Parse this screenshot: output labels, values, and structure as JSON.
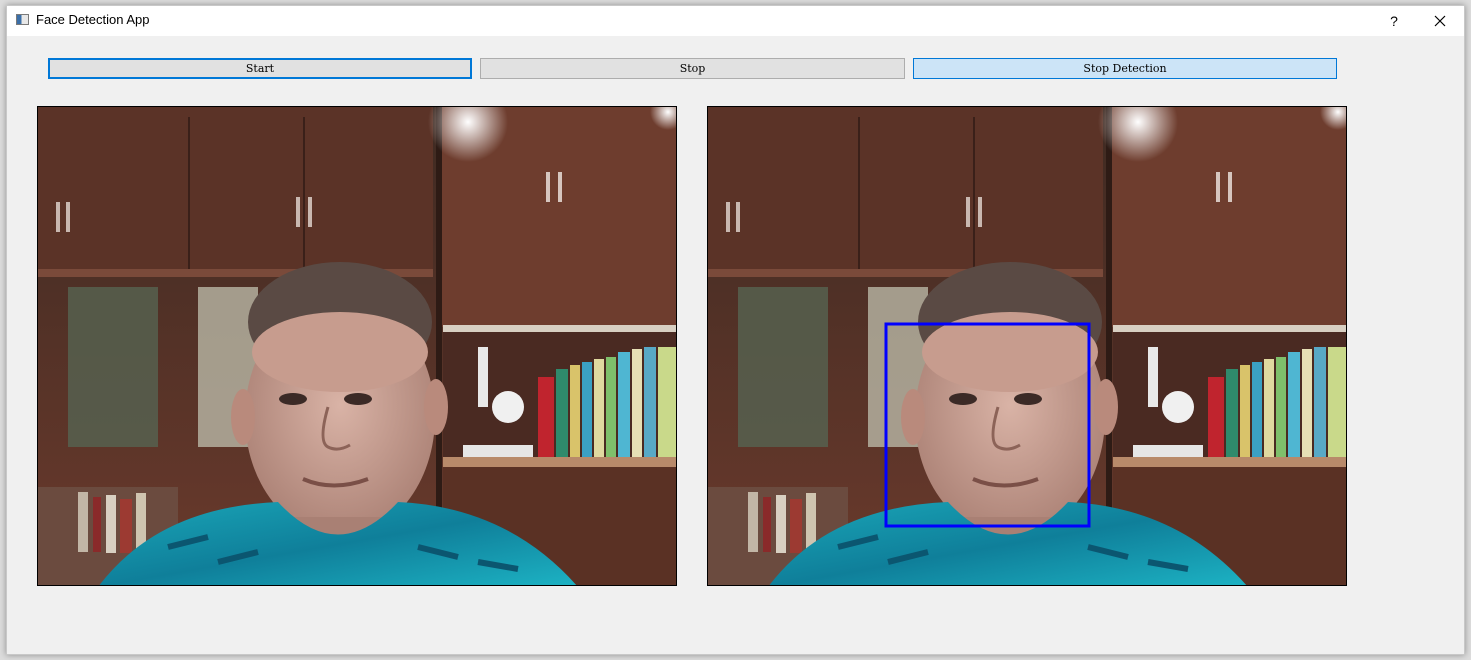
{
  "window": {
    "title": "Face Detection App",
    "help_label": "?",
    "close_label": "✕",
    "app_icon": "window-app-icon"
  },
  "toolbar": {
    "start_label": "Start",
    "stop_label": "Stop",
    "stop_detection_label": "Stop Detection"
  },
  "views": {
    "original": {
      "content": "live-camera-feed"
    },
    "detection": {
      "content": "camera-feed-with-face-box",
      "box_color": "#0000ff"
    }
  },
  "colors": {
    "focus_border": "#0078d7",
    "pressed_fill": "#cce4f7",
    "button_fill": "#e1e1e1",
    "detection_box": "#0000ff"
  }
}
